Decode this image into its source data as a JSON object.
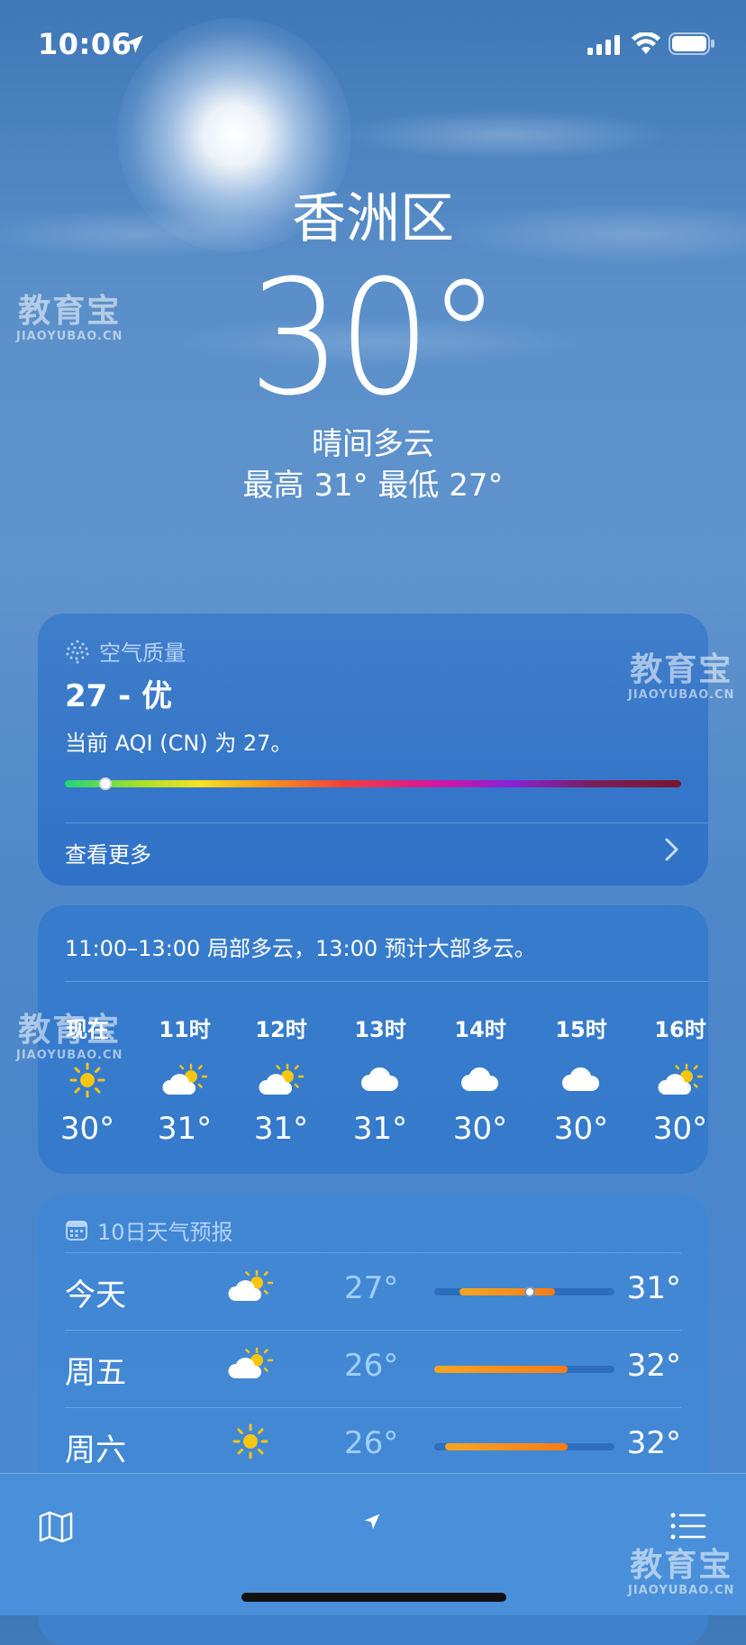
{
  "status_bar": {
    "time": "10:06"
  },
  "hero": {
    "city": "香洲区",
    "temperature": "30°",
    "condition": "晴间多云",
    "high_low": "最高 31°  最低 27°"
  },
  "air_quality": {
    "header": "空气质量",
    "value_label": "27 - 优",
    "description": "当前 AQI (CN) 为 27。",
    "aqi": 27,
    "see_more": "查看更多"
  },
  "hourly": {
    "summary": "11:00–13:00 局部多云，13:00 预计大部多云。",
    "hours": [
      {
        "label": "现在",
        "icon": "sun-icon",
        "temp": "30°"
      },
      {
        "label": "11时",
        "icon": "partly-cloudy-icon",
        "temp": "31°"
      },
      {
        "label": "12时",
        "icon": "partly-cloudy-icon",
        "temp": "31°"
      },
      {
        "label": "13时",
        "icon": "cloud-icon",
        "temp": "31°"
      },
      {
        "label": "14时",
        "icon": "cloud-icon",
        "temp": "30°"
      },
      {
        "label": "15时",
        "icon": "cloud-icon",
        "temp": "30°"
      },
      {
        "label": "16时",
        "icon": "partly-cloudy-icon",
        "temp": "30°"
      }
    ]
  },
  "daily": {
    "header": "10日天气预报",
    "days": [
      {
        "name": "今天",
        "icon": "partly-cloudy-icon",
        "low": "27°",
        "high": "31°"
      },
      {
        "name": "周五",
        "icon": "partly-cloudy-icon",
        "low": "26°",
        "high": "32°"
      },
      {
        "name": "周六",
        "icon": "sun-icon",
        "low": "26°",
        "high": "32°"
      }
    ]
  },
  "watermark": {
    "big": "教育宝",
    "small": "JIAOYUBAO.CN"
  },
  "colors": {
    "sun": "#f7c512",
    "temp_bar": "#f97b16",
    "aqi_good": "#22d47a"
  }
}
